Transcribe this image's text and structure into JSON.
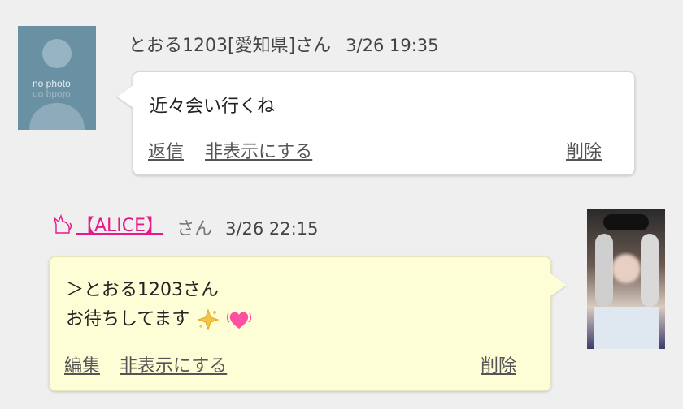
{
  "messages": [
    {
      "author": "とおる1203[愛知県]さん",
      "time": "3/26 19:35",
      "avatar_text": "no photo",
      "text": "近々会い行くね",
      "actions": {
        "reply": "返信",
        "hide": "非表示にする",
        "delete": "削除"
      }
    },
    {
      "author_brand": "【ALICE】",
      "author_suffix": "さん",
      "time": "3/26 22:15",
      "text_lines": [
        "＞とおる1203さん",
        "お待ちしてます"
      ],
      "actions": {
        "edit": "編集",
        "hide": "非表示にする",
        "delete": "削除"
      }
    }
  ],
  "colors": {
    "brand": "#e41a87",
    "bubble_in": "#ffffff",
    "bubble_out": "#fdfdd6",
    "background": "#efefef"
  }
}
